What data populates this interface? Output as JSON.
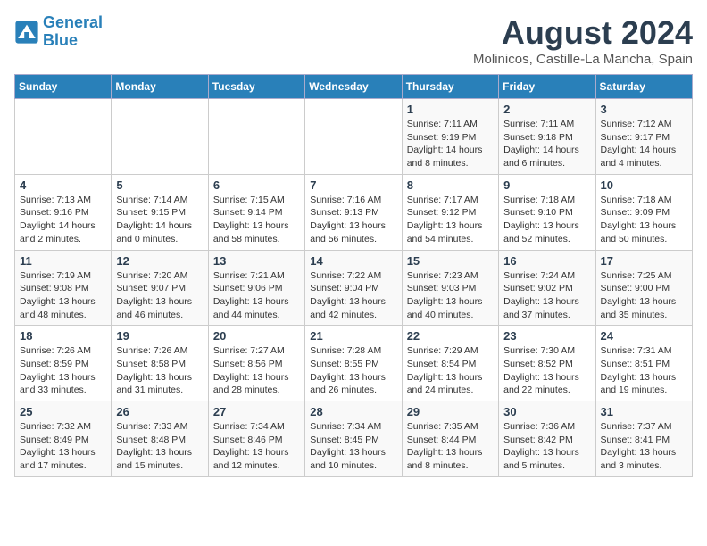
{
  "logo": {
    "line1": "General",
    "line2": "Blue"
  },
  "title": "August 2024",
  "subtitle": "Molinicos, Castille-La Mancha, Spain",
  "weekdays": [
    "Sunday",
    "Monday",
    "Tuesday",
    "Wednesday",
    "Thursday",
    "Friday",
    "Saturday"
  ],
  "weeks": [
    [
      {
        "day": "",
        "info": ""
      },
      {
        "day": "",
        "info": ""
      },
      {
        "day": "",
        "info": ""
      },
      {
        "day": "",
        "info": ""
      },
      {
        "day": "1",
        "info": "Sunrise: 7:11 AM\nSunset: 9:19 PM\nDaylight: 14 hours\nand 8 minutes."
      },
      {
        "day": "2",
        "info": "Sunrise: 7:11 AM\nSunset: 9:18 PM\nDaylight: 14 hours\nand 6 minutes."
      },
      {
        "day": "3",
        "info": "Sunrise: 7:12 AM\nSunset: 9:17 PM\nDaylight: 14 hours\nand 4 minutes."
      }
    ],
    [
      {
        "day": "4",
        "info": "Sunrise: 7:13 AM\nSunset: 9:16 PM\nDaylight: 14 hours\nand 2 minutes."
      },
      {
        "day": "5",
        "info": "Sunrise: 7:14 AM\nSunset: 9:15 PM\nDaylight: 14 hours\nand 0 minutes."
      },
      {
        "day": "6",
        "info": "Sunrise: 7:15 AM\nSunset: 9:14 PM\nDaylight: 13 hours\nand 58 minutes."
      },
      {
        "day": "7",
        "info": "Sunrise: 7:16 AM\nSunset: 9:13 PM\nDaylight: 13 hours\nand 56 minutes."
      },
      {
        "day": "8",
        "info": "Sunrise: 7:17 AM\nSunset: 9:12 PM\nDaylight: 13 hours\nand 54 minutes."
      },
      {
        "day": "9",
        "info": "Sunrise: 7:18 AM\nSunset: 9:10 PM\nDaylight: 13 hours\nand 52 minutes."
      },
      {
        "day": "10",
        "info": "Sunrise: 7:18 AM\nSunset: 9:09 PM\nDaylight: 13 hours\nand 50 minutes."
      }
    ],
    [
      {
        "day": "11",
        "info": "Sunrise: 7:19 AM\nSunset: 9:08 PM\nDaylight: 13 hours\nand 48 minutes."
      },
      {
        "day": "12",
        "info": "Sunrise: 7:20 AM\nSunset: 9:07 PM\nDaylight: 13 hours\nand 46 minutes."
      },
      {
        "day": "13",
        "info": "Sunrise: 7:21 AM\nSunset: 9:06 PM\nDaylight: 13 hours\nand 44 minutes."
      },
      {
        "day": "14",
        "info": "Sunrise: 7:22 AM\nSunset: 9:04 PM\nDaylight: 13 hours\nand 42 minutes."
      },
      {
        "day": "15",
        "info": "Sunrise: 7:23 AM\nSunset: 9:03 PM\nDaylight: 13 hours\nand 40 minutes."
      },
      {
        "day": "16",
        "info": "Sunrise: 7:24 AM\nSunset: 9:02 PM\nDaylight: 13 hours\nand 37 minutes."
      },
      {
        "day": "17",
        "info": "Sunrise: 7:25 AM\nSunset: 9:00 PM\nDaylight: 13 hours\nand 35 minutes."
      }
    ],
    [
      {
        "day": "18",
        "info": "Sunrise: 7:26 AM\nSunset: 8:59 PM\nDaylight: 13 hours\nand 33 minutes."
      },
      {
        "day": "19",
        "info": "Sunrise: 7:26 AM\nSunset: 8:58 PM\nDaylight: 13 hours\nand 31 minutes."
      },
      {
        "day": "20",
        "info": "Sunrise: 7:27 AM\nSunset: 8:56 PM\nDaylight: 13 hours\nand 28 minutes."
      },
      {
        "day": "21",
        "info": "Sunrise: 7:28 AM\nSunset: 8:55 PM\nDaylight: 13 hours\nand 26 minutes."
      },
      {
        "day": "22",
        "info": "Sunrise: 7:29 AM\nSunset: 8:54 PM\nDaylight: 13 hours\nand 24 minutes."
      },
      {
        "day": "23",
        "info": "Sunrise: 7:30 AM\nSunset: 8:52 PM\nDaylight: 13 hours\nand 22 minutes."
      },
      {
        "day": "24",
        "info": "Sunrise: 7:31 AM\nSunset: 8:51 PM\nDaylight: 13 hours\nand 19 minutes."
      }
    ],
    [
      {
        "day": "25",
        "info": "Sunrise: 7:32 AM\nSunset: 8:49 PM\nDaylight: 13 hours\nand 17 minutes."
      },
      {
        "day": "26",
        "info": "Sunrise: 7:33 AM\nSunset: 8:48 PM\nDaylight: 13 hours\nand 15 minutes."
      },
      {
        "day": "27",
        "info": "Sunrise: 7:34 AM\nSunset: 8:46 PM\nDaylight: 13 hours\nand 12 minutes."
      },
      {
        "day": "28",
        "info": "Sunrise: 7:34 AM\nSunset: 8:45 PM\nDaylight: 13 hours\nand 10 minutes."
      },
      {
        "day": "29",
        "info": "Sunrise: 7:35 AM\nSunset: 8:44 PM\nDaylight: 13 hours\nand 8 minutes."
      },
      {
        "day": "30",
        "info": "Sunrise: 7:36 AM\nSunset: 8:42 PM\nDaylight: 13 hours\nand 5 minutes."
      },
      {
        "day": "31",
        "info": "Sunrise: 7:37 AM\nSunset: 8:41 PM\nDaylight: 13 hours\nand 3 minutes."
      }
    ]
  ]
}
